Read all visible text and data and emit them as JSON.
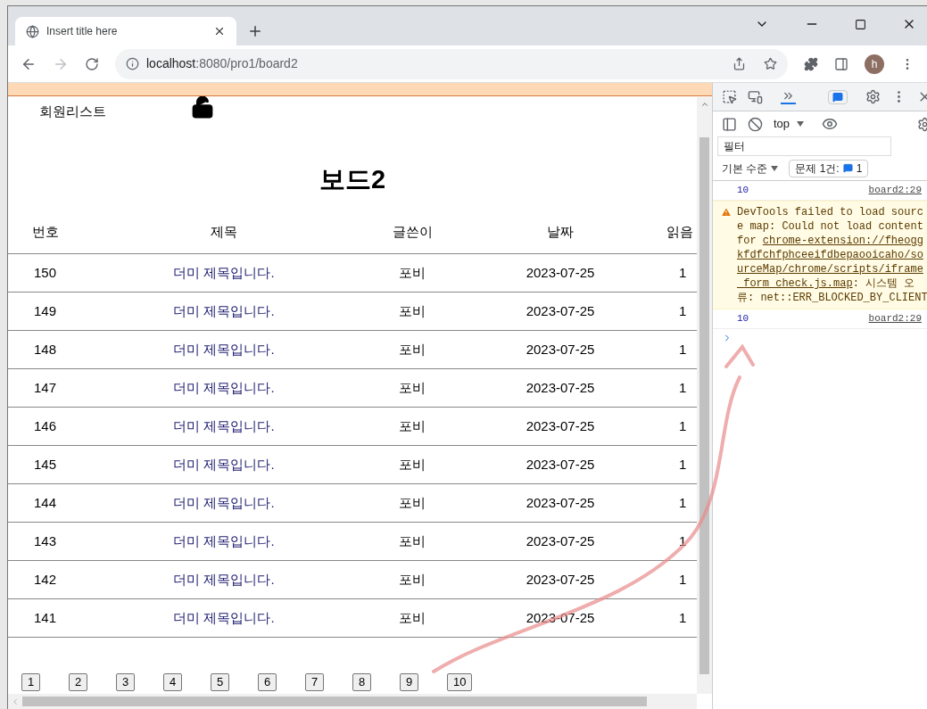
{
  "browser": {
    "tab_title": "Insert title here",
    "url_host": "localhost",
    "url_rest": ":8080/pro1/board2",
    "profile_initial": "h"
  },
  "page": {
    "nav_link": "회원리스트",
    "heading": "보드2",
    "columns": [
      "번호",
      "제목",
      "글쓴이",
      "날짜",
      "읽음"
    ],
    "rows": [
      {
        "no": "150",
        "title": "더미 제목입니다.",
        "writer": "포비",
        "date": "2023-07-25",
        "reads": "1"
      },
      {
        "no": "149",
        "title": "더미 제목입니다.",
        "writer": "포비",
        "date": "2023-07-25",
        "reads": "1"
      },
      {
        "no": "148",
        "title": "더미 제목입니다.",
        "writer": "포비",
        "date": "2023-07-25",
        "reads": "1"
      },
      {
        "no": "147",
        "title": "더미 제목입니다.",
        "writer": "포비",
        "date": "2023-07-25",
        "reads": "1"
      },
      {
        "no": "146",
        "title": "더미 제목입니다.",
        "writer": "포비",
        "date": "2023-07-25",
        "reads": "1"
      },
      {
        "no": "145",
        "title": "더미 제목입니다.",
        "writer": "포비",
        "date": "2023-07-25",
        "reads": "1"
      },
      {
        "no": "144",
        "title": "더미 제목입니다.",
        "writer": "포비",
        "date": "2023-07-25",
        "reads": "1"
      },
      {
        "no": "143",
        "title": "더미 제목입니다.",
        "writer": "포비",
        "date": "2023-07-25",
        "reads": "1"
      },
      {
        "no": "142",
        "title": "더미 제목입니다.",
        "writer": "포비",
        "date": "2023-07-25",
        "reads": "1"
      },
      {
        "no": "141",
        "title": "더미 제목입니다.",
        "writer": "포비",
        "date": "2023-07-25",
        "reads": "1"
      }
    ],
    "pages": [
      "1",
      "2",
      "3",
      "4",
      "5",
      "6",
      "7",
      "8",
      "9",
      "10"
    ]
  },
  "devtools": {
    "context": "top",
    "filter_placeholder": "필터",
    "levels": "기본 수준",
    "issues_label": "문제 1건:",
    "issues_count": "1",
    "messages": [
      {
        "kind": "log",
        "text": "10",
        "source": "board2:29"
      },
      {
        "kind": "warning",
        "parts": [
          "DevTools failed to load source map: Could not load content for ",
          "chrome-extension://fheoggkfdfchfphceeifdbepaooicaho/sourceMap/chrome/scripts/iframe_form_check.js.map",
          ": 시스템 오류: net::ERR_BLOCKED_BY_CLIENT"
        ]
      },
      {
        "kind": "log",
        "text": "10",
        "source": "board2:29"
      }
    ]
  }
}
